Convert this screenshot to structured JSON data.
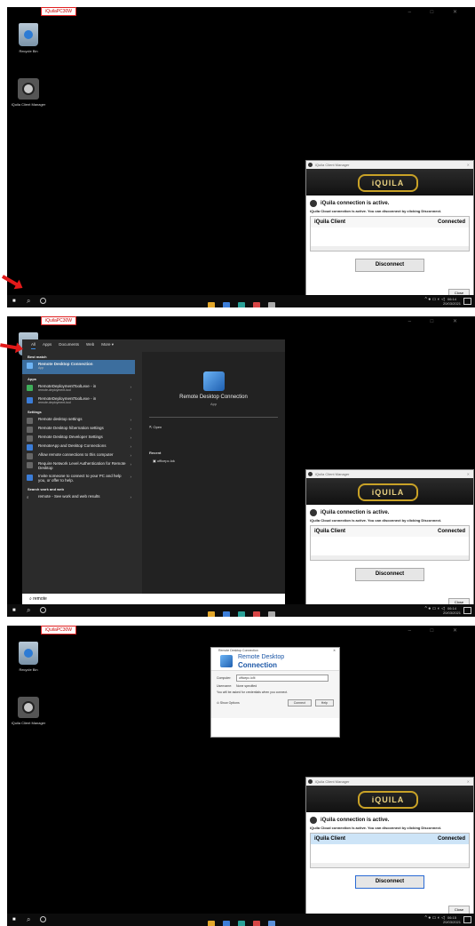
{
  "window": {
    "title_tag": "iQuilaPC30W"
  },
  "desktop": {
    "recycle_bin": "Recycle Bin",
    "iquila_manager": "iQuila Client Manager"
  },
  "taskbar": {
    "clock_time": "06:14",
    "clock_date": "20/03/2021",
    "clock_time3": "06:15"
  },
  "iquila": {
    "title": "iQuila Client Manager",
    "logo": "iQUILA",
    "status": "iQuila connection is active.",
    "subtext": "iQuila Cloud connection is active. You can disconnect by clicking Disconnect.",
    "col_name": "iQuila Client",
    "col_state": "Connected",
    "disconnect": "Disconnect",
    "close": "Close"
  },
  "start_menu": {
    "tabs": [
      "All",
      "Apps",
      "Documents",
      "Web",
      "More ▾"
    ],
    "best_match_header": "Best match",
    "best_match_name": "Remote Desktop Connection",
    "best_match_type": "App",
    "apps_header": "Apps",
    "apps": [
      {
        "label": "RemoteDeploymentToolLexe - in",
        "sub": "remote-deployment-tool"
      },
      {
        "label": "RemoteDeploymentToolLexe - in",
        "sub": "remote-deployment-tool"
      }
    ],
    "settings_header": "Settings",
    "settings": [
      "Remote desktop settings",
      "Remote Desktop hibernation settings",
      "Remote Desktop Developer Settings",
      "RemoteApp and Desktop Connections",
      "Allow remote connections to this computer",
      "Require Network Level Authentication for Remote Desktop",
      "Invite someone to connect to your PC and help you, or offer to help."
    ],
    "web_header": "Search work and web",
    "web_item": "remote - See work and web results",
    "right_name": "Remote Desktop Connection",
    "right_type": "App",
    "open": "Open",
    "recent": "Recent",
    "recent_item": "officepc.lok",
    "search_text": "remote"
  },
  "rdc": {
    "title": "Remote Desktop Connection",
    "line1": "Remote Desktop",
    "line2": "Connection",
    "computer_label": "Computer:",
    "computer_value": "officepc.lo9l",
    "username_label": "Username:",
    "username_value": "None specified",
    "note": "You will be asked for credentials when you connect.",
    "show_options": "Show Options",
    "connect": "Connect",
    "help": "Help"
  }
}
